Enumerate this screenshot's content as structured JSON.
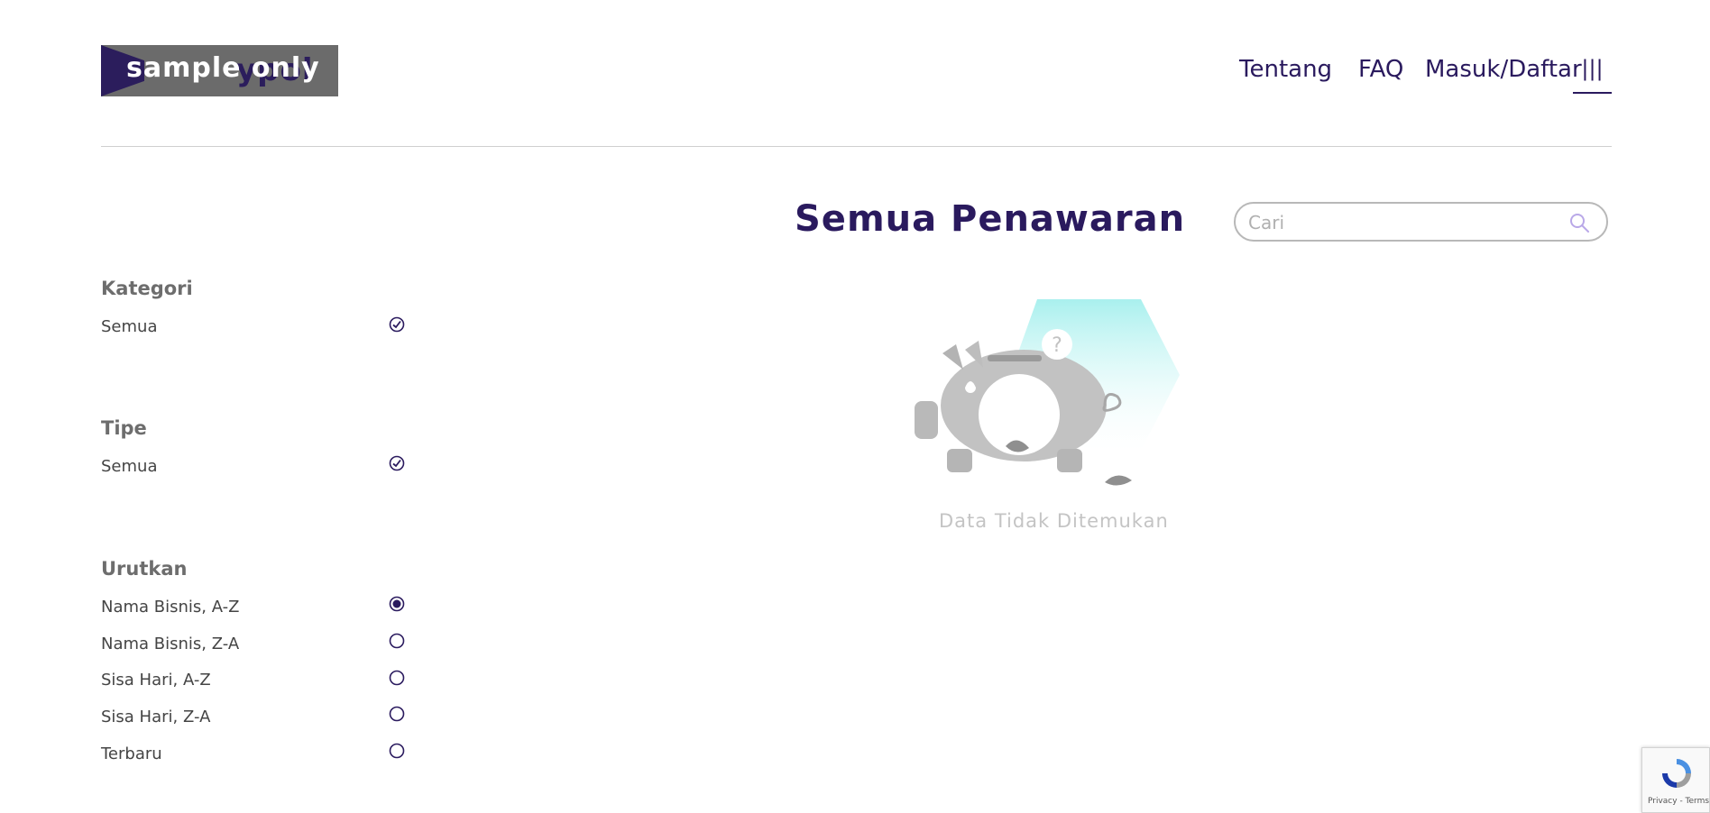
{
  "logo": {
    "watermark_text": "sample only",
    "brand_fragment": "ypol"
  },
  "nav": {
    "items": [
      {
        "label": "Tentang"
      },
      {
        "label": "FAQ"
      },
      {
        "label": "Masuk/Daftar"
      }
    ],
    "menu_label": "|||"
  },
  "page": {
    "title": "Semua Penawaran"
  },
  "search": {
    "placeholder": "Cari"
  },
  "filters": {
    "kategori": {
      "heading": "Kategori",
      "options": [
        {
          "label": "Semua",
          "checked": true
        }
      ]
    },
    "tipe": {
      "heading": "Tipe",
      "options": [
        {
          "label": "Semua",
          "checked": true
        }
      ]
    },
    "urutkan": {
      "heading": "Urutkan",
      "options": [
        {
          "label": "Nama Bisnis, A-Z",
          "selected": true
        },
        {
          "label": "Nama Bisnis, Z-A",
          "selected": false
        },
        {
          "label": "Sisa Hari, A-Z",
          "selected": false
        },
        {
          "label": "Sisa Hari, Z-A",
          "selected": false
        },
        {
          "label": "Terbaru",
          "selected": false
        }
      ]
    }
  },
  "empty_state": {
    "message": "Data Tidak Ditemukan",
    "icon": "piggy-bank-icon",
    "badge": "?"
  },
  "recaptcha": {
    "footer": "Privacy - Terms"
  },
  "colors": {
    "primary": "#2a1a5e",
    "muted": "#c4c4c4",
    "divider": "#cfcfcf",
    "accent": "#a9f0ee"
  }
}
